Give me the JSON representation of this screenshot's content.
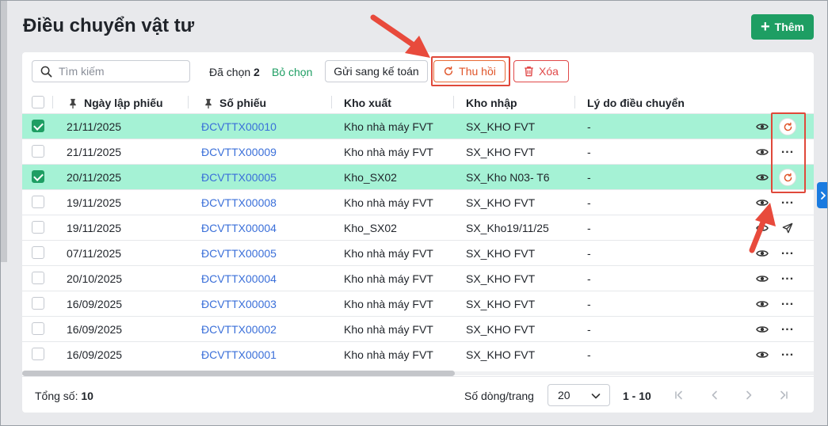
{
  "page": {
    "title": "Điều chuyển vật tư",
    "add_label": "Thêm"
  },
  "toolbar": {
    "search_placeholder": "Tìm kiếm",
    "selected_prefix": "Đã chọn",
    "selected_count": "2",
    "deselect_label": "Bỏ chọn",
    "send_label": "Gửi sang kế toán",
    "recall_label": "Thu hồi",
    "delete_label": "Xóa"
  },
  "table": {
    "columns": [
      "Ngày lập phiếu",
      "Số phiếu",
      "Kho xuất",
      "Kho nhập",
      "Lý do điều chuyển"
    ],
    "rows": [
      {
        "date": "21/11/2025",
        "number": "ĐCVTTX00010",
        "from": "Kho nhà máy FVT",
        "to": "SX_KHO FVT",
        "reason": "-",
        "selected": true,
        "action": "recall"
      },
      {
        "date": "21/11/2025",
        "number": "ĐCVTTX00009",
        "from": "Kho nhà máy FVT",
        "to": "SX_KHO FVT",
        "reason": "-",
        "selected": false,
        "action": "more"
      },
      {
        "date": "20/11/2025",
        "number": "ĐCVTTX00005",
        "from": "Kho_SX02",
        "to": "SX_Kho N03- T6",
        "reason": "-",
        "selected": true,
        "action": "recall"
      },
      {
        "date": "19/11/2025",
        "number": "ĐCVTTX00008",
        "from": "Kho nhà máy FVT",
        "to": "SX_KHO FVT",
        "reason": "-",
        "selected": false,
        "action": "more"
      },
      {
        "date": "19/11/2025",
        "number": "ĐCVTTX00004",
        "from": "Kho_SX02",
        "to": "SX_Kho19/11/25",
        "reason": "-",
        "selected": false,
        "action": "send"
      },
      {
        "date": "07/11/2025",
        "number": "ĐCVTTX00005",
        "from": "Kho nhà máy FVT",
        "to": "SX_KHO FVT",
        "reason": "-",
        "selected": false,
        "action": "more"
      },
      {
        "date": "20/10/2025",
        "number": "ĐCVTTX00004",
        "from": "Kho nhà máy FVT",
        "to": "SX_KHO FVT",
        "reason": "-",
        "selected": false,
        "action": "more"
      },
      {
        "date": "16/09/2025",
        "number": "ĐCVTTX00003",
        "from": "Kho nhà máy FVT",
        "to": "SX_KHO FVT",
        "reason": "-",
        "selected": false,
        "action": "more"
      },
      {
        "date": "16/09/2025",
        "number": "ĐCVTTX00002",
        "from": "Kho nhà máy FVT",
        "to": "SX_KHO FVT",
        "reason": "-",
        "selected": false,
        "action": "more"
      },
      {
        "date": "16/09/2025",
        "number": "ĐCVTTX00001",
        "from": "Kho nhà máy FVT",
        "to": "SX_KHO FVT",
        "reason": "-",
        "selected": false,
        "action": "more"
      }
    ]
  },
  "footer": {
    "total_label": "Tổng số:",
    "total_value": "10",
    "rows_per_page_label": "Số dòng/trang",
    "rows_per_page_value": "20",
    "page_range": "1 - 10"
  },
  "colors": {
    "primary": "#1e9e63",
    "selected_row": "#a5f2d5",
    "link": "#3a6fd9",
    "recall": "#e0552a",
    "danger": "#e04848",
    "annotation": "#e0493a"
  },
  "icons": [
    "search-icon",
    "recall-icon",
    "trash-icon",
    "pin-icon",
    "eye-icon",
    "more-icon",
    "send-icon",
    "chevron-down-icon",
    "first-page-icon",
    "prev-page-icon",
    "next-page-icon",
    "last-page-icon",
    "chevron-right-icon",
    "annotation-arrow-icon"
  ]
}
